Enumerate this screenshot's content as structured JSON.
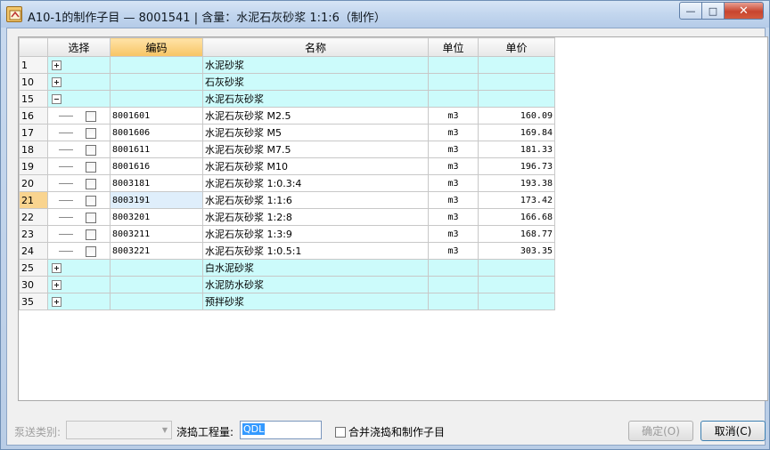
{
  "window": {
    "title": "A10-1的制作子目 — 8001541 | 含量：水泥石灰砂浆 1:1:6（制作）",
    "min_glyph": "—",
    "max_glyph": "□",
    "close_glyph": "✕"
  },
  "grid": {
    "columns": [
      "",
      "选择",
      "编码",
      "名称",
      "单位",
      "单价"
    ],
    "rows": [
      {
        "num": "1",
        "type": "group",
        "expander": "plus",
        "code": "",
        "name": "水泥砂浆",
        "unit": "",
        "price": ""
      },
      {
        "num": "10",
        "type": "group",
        "expander": "plus",
        "code": "",
        "name": "石灰砂浆",
        "unit": "",
        "price": ""
      },
      {
        "num": "15",
        "type": "group",
        "expander": "minus",
        "code": "",
        "name": "水泥石灰砂浆",
        "unit": "",
        "price": ""
      },
      {
        "num": "16",
        "type": "item",
        "code": "8001601",
        "name": "水泥石灰砂浆 M2.5",
        "unit": "m3",
        "price": "160.09"
      },
      {
        "num": "17",
        "type": "item",
        "code": "8001606",
        "name": "水泥石灰砂浆 M5",
        "unit": "m3",
        "price": "169.84"
      },
      {
        "num": "18",
        "type": "item",
        "code": "8001611",
        "name": "水泥石灰砂浆 M7.5",
        "unit": "m3",
        "price": "181.33"
      },
      {
        "num": "19",
        "type": "item",
        "code": "8001616",
        "name": "水泥石灰砂浆 M10",
        "unit": "m3",
        "price": "196.73"
      },
      {
        "num": "20",
        "type": "item",
        "code": "8003181",
        "name": "水泥石灰砂浆 1:0.3:4",
        "unit": "m3",
        "price": "193.38"
      },
      {
        "num": "21",
        "type": "item",
        "code": "8003191",
        "name": "水泥石灰砂浆 1:1:6",
        "unit": "m3",
        "price": "173.42",
        "active": true
      },
      {
        "num": "22",
        "type": "item",
        "code": "8003201",
        "name": "水泥石灰砂浆 1:2:8",
        "unit": "m3",
        "price": "166.68"
      },
      {
        "num": "23",
        "type": "item",
        "code": "8003211",
        "name": "水泥石灰砂浆 1:3:9",
        "unit": "m3",
        "price": "168.77"
      },
      {
        "num": "24",
        "type": "item",
        "code": "8003221",
        "name": "水泥石灰砂浆 1:0.5:1",
        "unit": "m3",
        "price": "303.35",
        "last": true
      },
      {
        "num": "25",
        "type": "group",
        "expander": "plus",
        "code": "",
        "name": "白水泥砂浆",
        "unit": "",
        "price": ""
      },
      {
        "num": "30",
        "type": "group",
        "expander": "plus",
        "code": "",
        "name": "水泥防水砂浆",
        "unit": "",
        "price": ""
      },
      {
        "num": "35",
        "type": "group",
        "expander": "plus",
        "code": "",
        "name": "预拌砂浆",
        "unit": "",
        "price": ""
      }
    ]
  },
  "footer": {
    "pump_label": "泵送类别:",
    "pump_value": "",
    "qty_label": "浇捣工程量:",
    "qty_value": "QDL",
    "merge_label": "合并浇捣和制作子目",
    "ok_label": "确定(O)",
    "cancel_label": "取消(C)"
  },
  "colors": {
    "group_row_bg": "#ccfbfb",
    "active_row_num_bg": "#f9d48f",
    "sorted_header_bg": "#f7c463"
  }
}
